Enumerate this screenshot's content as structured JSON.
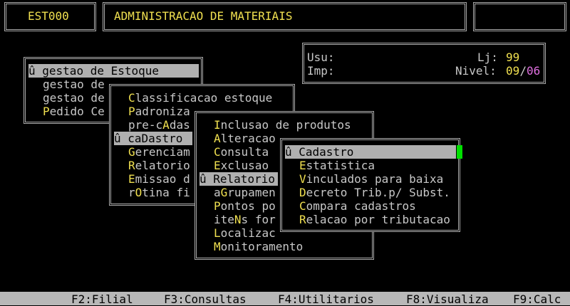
{
  "header": {
    "program_code": "EST000",
    "title": "ADMINISTRACAO DE MATERIAIS"
  },
  "info": {
    "usu_label": "Usu:",
    "lj_label": "Lj:",
    "lj_value": "99",
    "imp_label": "Imp:",
    "nivel_label": "Nivel:",
    "nivel_value": "09",
    "nivel_sep": "/",
    "nivel_max": "06"
  },
  "menu1": {
    "items": [
      {
        "hotkey": "û",
        "rest": " gestao de Estoque",
        "selected": true
      },
      {
        "hotkey": "",
        "rest": "gestao de",
        "selected": false
      },
      {
        "hotkey": "",
        "rest": "gestao de",
        "selected": false
      },
      {
        "hotkey": "P",
        "rest": "edido Ce",
        "selected": false
      }
    ]
  },
  "menu2": {
    "items": [
      {
        "pre": "",
        "hotkey": "C",
        "rest": "lassificacao estoque"
      },
      {
        "pre": "",
        "hotkey": "P",
        "rest": "adroniza"
      },
      {
        "pre": "pre-c",
        "hotkey": "A",
        "rest": "das"
      },
      {
        "pre": "û ca",
        "hotkey": "D",
        "rest": "astro",
        "selected": true
      },
      {
        "pre": "",
        "hotkey": "G",
        "rest": "erenciam"
      },
      {
        "pre": "",
        "hotkey": "R",
        "rest": "elatorio"
      },
      {
        "pre": "",
        "hotkey": "E",
        "rest": "missao d"
      },
      {
        "pre": "r",
        "hotkey": "O",
        "rest": "tina fi"
      }
    ]
  },
  "menu3": {
    "items": [
      {
        "pre": "",
        "hotkey": "I",
        "rest": "nclusao de produtos"
      },
      {
        "pre": "",
        "hotkey": "A",
        "rest": "lteracao"
      },
      {
        "pre": "",
        "hotkey": "C",
        "rest": "onsulta"
      },
      {
        "pre": "",
        "hotkey": "E",
        "rest": "xclusao"
      },
      {
        "pre": "û ",
        "hotkey": "R",
        "rest": "elatorio",
        "selected": true
      },
      {
        "pre": "a",
        "hotkey": "G",
        "rest": "rupamen"
      },
      {
        "pre": "",
        "hotkey": "P",
        "rest": "ontos po"
      },
      {
        "pre": "ite",
        "hotkey": "N",
        "rest": "s for"
      },
      {
        "pre": "",
        "hotkey": "L",
        "rest": "ocalizac"
      },
      {
        "pre": "",
        "hotkey": "M",
        "rest": "onitoramento"
      }
    ]
  },
  "menu4": {
    "items": [
      {
        "pre": "û ",
        "hotkey": "C",
        "rest": "adastro",
        "selected": true
      },
      {
        "pre": "",
        "hotkey": "E",
        "rest": "statistica"
      },
      {
        "pre": "",
        "hotkey": "V",
        "rest": "inculados para baixa"
      },
      {
        "pre": "",
        "hotkey": "D",
        "rest": "ecreto Trib.p/ Subst."
      },
      {
        "pre": "",
        "hotkey": "C",
        "rest": "ompara cadastros"
      },
      {
        "pre": "",
        "hotkey": "R",
        "rest": "elacao por tributacao"
      }
    ]
  },
  "statusbar": {
    "f2": "F2:Filial",
    "f3": "F3:Consultas",
    "f4": "F4:Utilitarios",
    "f8": "F8:Visualiza",
    "f9": "F9:Calc"
  }
}
